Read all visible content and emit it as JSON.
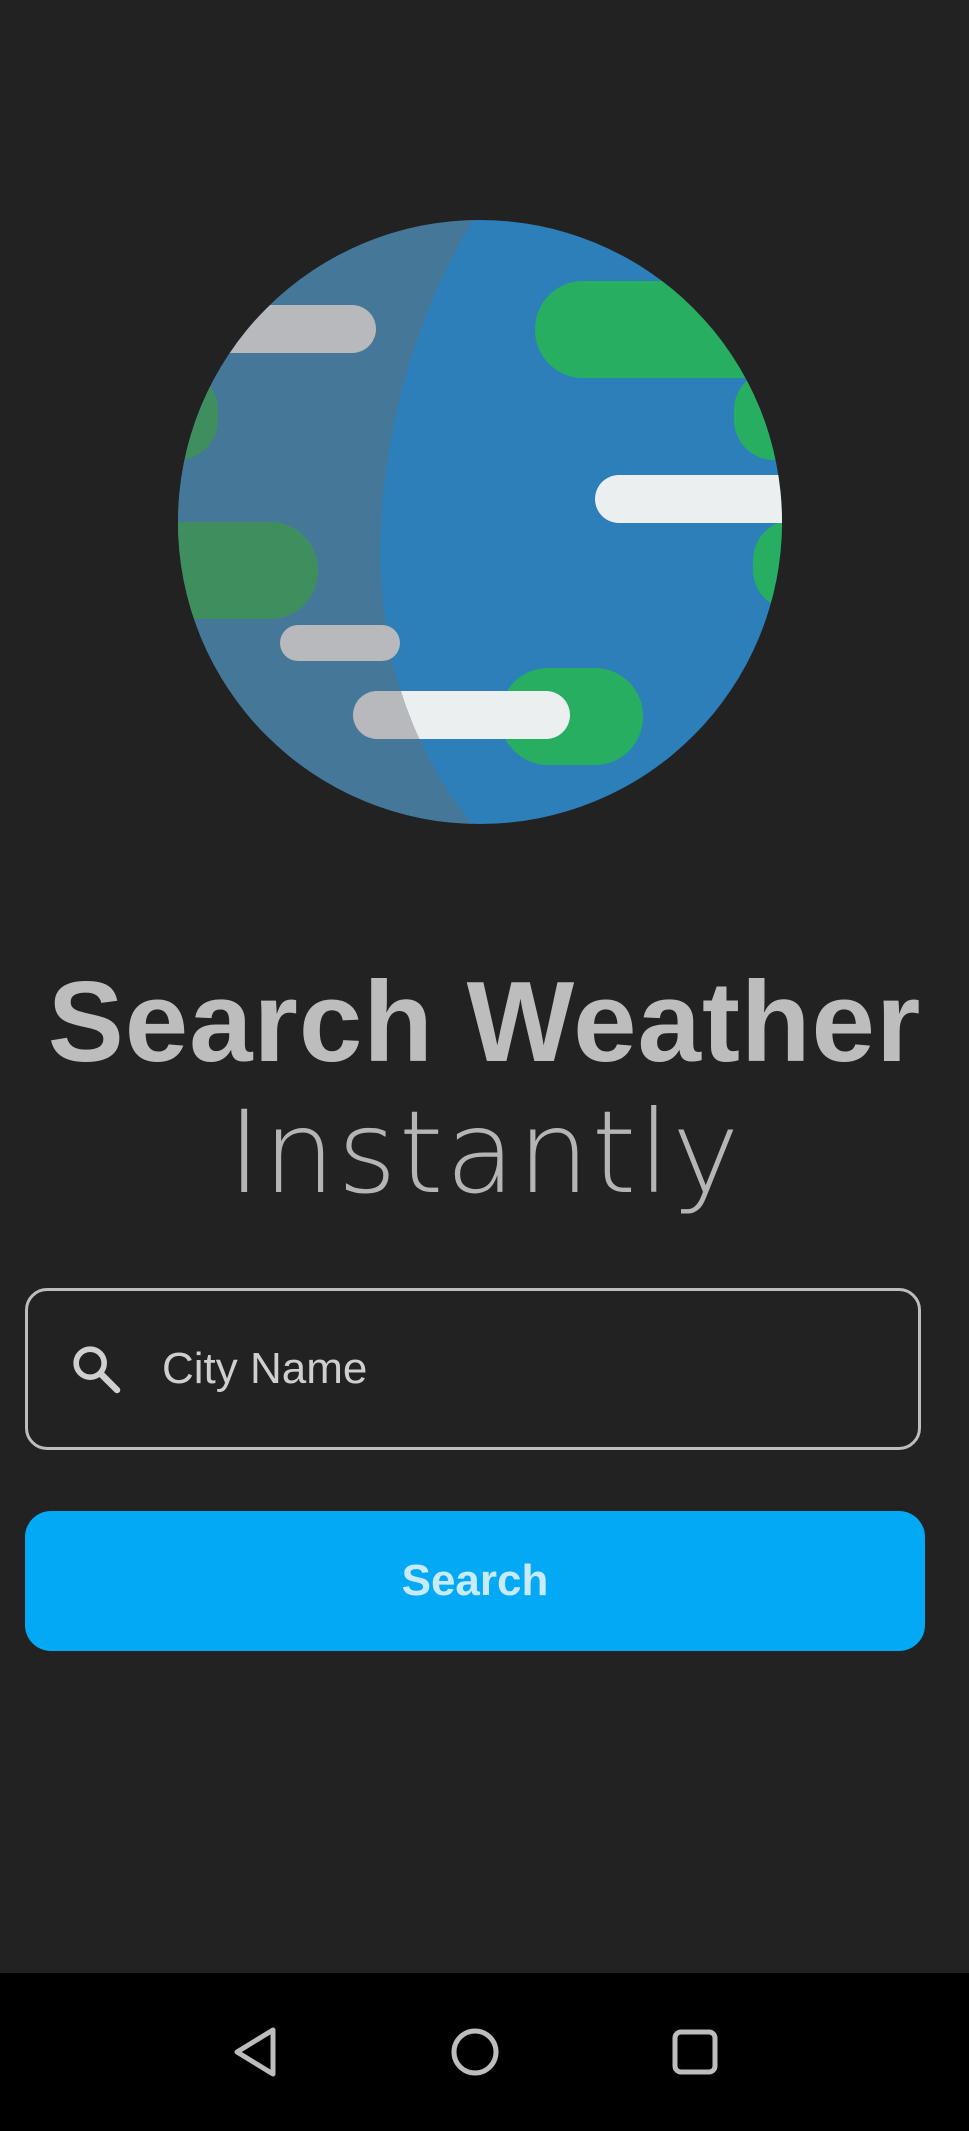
{
  "header": {
    "title": "Search Weather",
    "subtitle": "Instantly"
  },
  "search": {
    "placeholder": "City Name",
    "value": "",
    "button_label": "Search",
    "icon": "search-icon"
  },
  "illustration": {
    "name": "globe-illustration",
    "colors": {
      "ocean": "#2d7fba",
      "ocean_shadow": "#457898",
      "land": "#27ae60",
      "land_shadow": "#3f8f5e",
      "cloud": "#eceff0",
      "cloud_shadow": "#b8b9bc"
    }
  },
  "navigation": {
    "items": [
      {
        "name": "back-icon"
      },
      {
        "name": "home-icon"
      },
      {
        "name": "recents-icon"
      }
    ]
  },
  "colors": {
    "background": "#222222",
    "accent": "#03a9f4",
    "text": "#bdbdbd"
  }
}
